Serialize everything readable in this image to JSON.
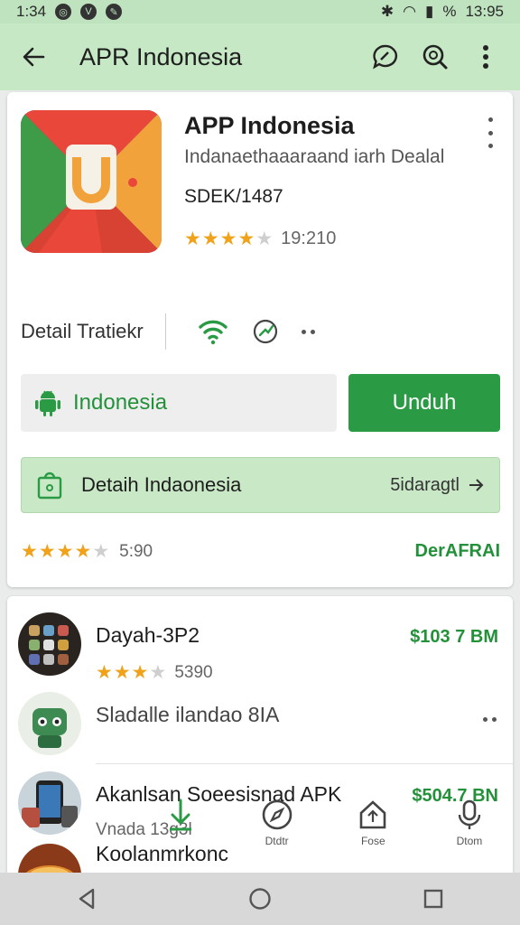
{
  "status_bar": {
    "time_left": "1:34",
    "time_right": "13:95"
  },
  "app_bar": {
    "title": "APR Indonesia",
    "back_icon": "arrow-left-icon",
    "actions": [
      "chat-icon",
      "search-icon",
      "more-vert-icon"
    ]
  },
  "app": {
    "name": "APP Indonesia",
    "subtitle": "Indanaethaaaraand iarh Dealal",
    "version": "SDEK/1487",
    "stars": 4,
    "rating_count": "19:210"
  },
  "actions_row": {
    "detail_label": "Detail Tratiekr",
    "icons": [
      "wifi-icon",
      "share-icon",
      "more-horiz-icon"
    ]
  },
  "buttons": {
    "secondary_label": "Indonesia",
    "primary_label": "Unduh"
  },
  "info_bar": {
    "label": "Detaih Indaonesia",
    "right_text": "5idaragtl"
  },
  "rating_row": {
    "stars": 4,
    "count": "5:90",
    "link": "DerAFRAI"
  },
  "list": [
    {
      "title": "Dayah-3P2",
      "stars": 3,
      "sub": "5390",
      "price": "$103 7 BM"
    },
    {
      "title": "Sladalle ilandao 8IA",
      "sub": ""
    },
    {
      "title": "Akanlsan Soeesisnad APK",
      "sub": "Vnada 13g3l",
      "price": "$504.7 BN"
    },
    {
      "title": "Koolanmrkonc",
      "sub": ""
    }
  ],
  "bottom_nav": [
    {
      "label": "",
      "icon": "download-icon"
    },
    {
      "label": "Dtdtr",
      "icon": "explore-icon"
    },
    {
      "label": "Fose",
      "icon": "home-icon"
    },
    {
      "label": "Dtom",
      "icon": "mic-icon"
    }
  ],
  "colors": {
    "accent": "#2a9a44",
    "appbar": "#c6e8c4",
    "star": "#f0a21a"
  }
}
